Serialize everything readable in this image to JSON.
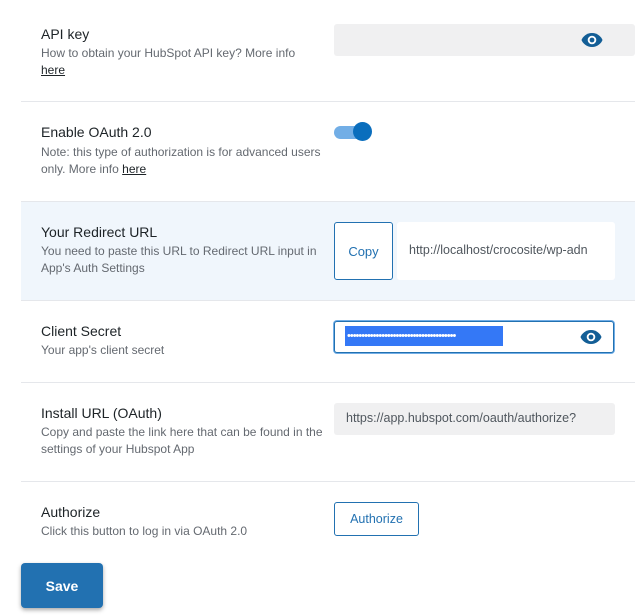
{
  "api_key": {
    "label": "API key",
    "desc_prefix": "How to obtain your HubSpot API key? More info",
    "link": "here",
    "value": ""
  },
  "oauth": {
    "label": "Enable OAuth 2.0",
    "desc_prefix": "Note: this type of authorization is for advanced users only. More info",
    "link": "here",
    "enabled": true
  },
  "redirect": {
    "label": "Your Redirect URL",
    "desc": "You need to paste this URL to Redirect URL input in App's Auth Settings",
    "copy_label": "Copy",
    "value": "http://localhost/crocosite/wp-adn"
  },
  "client_secret": {
    "label": "Client Secret",
    "desc": "Your app's client secret",
    "masked_value": "••••••••••••••••••••••••••••••••••••••"
  },
  "install_url": {
    "label": "Install URL (OAuth)",
    "desc": "Copy and paste the link here that can be found in the settings of your Hubspot App",
    "value": "https://app.hubspot.com/oauth/authorize?"
  },
  "authorize": {
    "label": "Authorize",
    "desc": "Click this button to log in via OAuth 2.0",
    "button_label": "Authorize"
  },
  "save_label": "Save"
}
